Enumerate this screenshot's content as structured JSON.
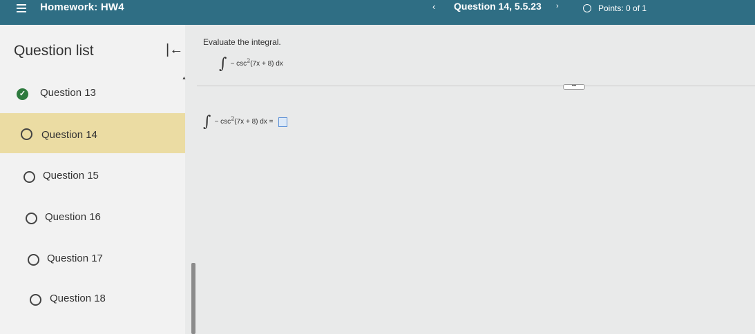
{
  "header": {
    "title": "Homework: HW4",
    "question": "Question 14, 5.5.23",
    "prev_glyph": "‹",
    "next_glyph": "›",
    "points": "Points: 0 of 1"
  },
  "sidebar": {
    "title": "Question list",
    "collapse_glyph": "|←",
    "items": [
      {
        "label": "Question 13",
        "status": "complete"
      },
      {
        "label": "Question 14",
        "status": "current"
      },
      {
        "label": "Question 15",
        "status": "open"
      },
      {
        "label": "Question 16",
        "status": "open"
      },
      {
        "label": "Question 17",
        "status": "open"
      },
      {
        "label": "Question 18",
        "status": "open"
      }
    ]
  },
  "main": {
    "instruction": "Evaluate the integral.",
    "integral_sign": "∫",
    "problem_prefix": "− csc",
    "problem_exp": "2",
    "problem_suffix": "(7x + 8) dx",
    "answer_suffix": "(7x + 8) dx =",
    "more_label": "•••"
  },
  "colors": {
    "topbar": "#2f6e84",
    "active_item": "#ebdca3",
    "complete_check": "#2e7a3e",
    "answer_box": "#5a8fd6"
  }
}
